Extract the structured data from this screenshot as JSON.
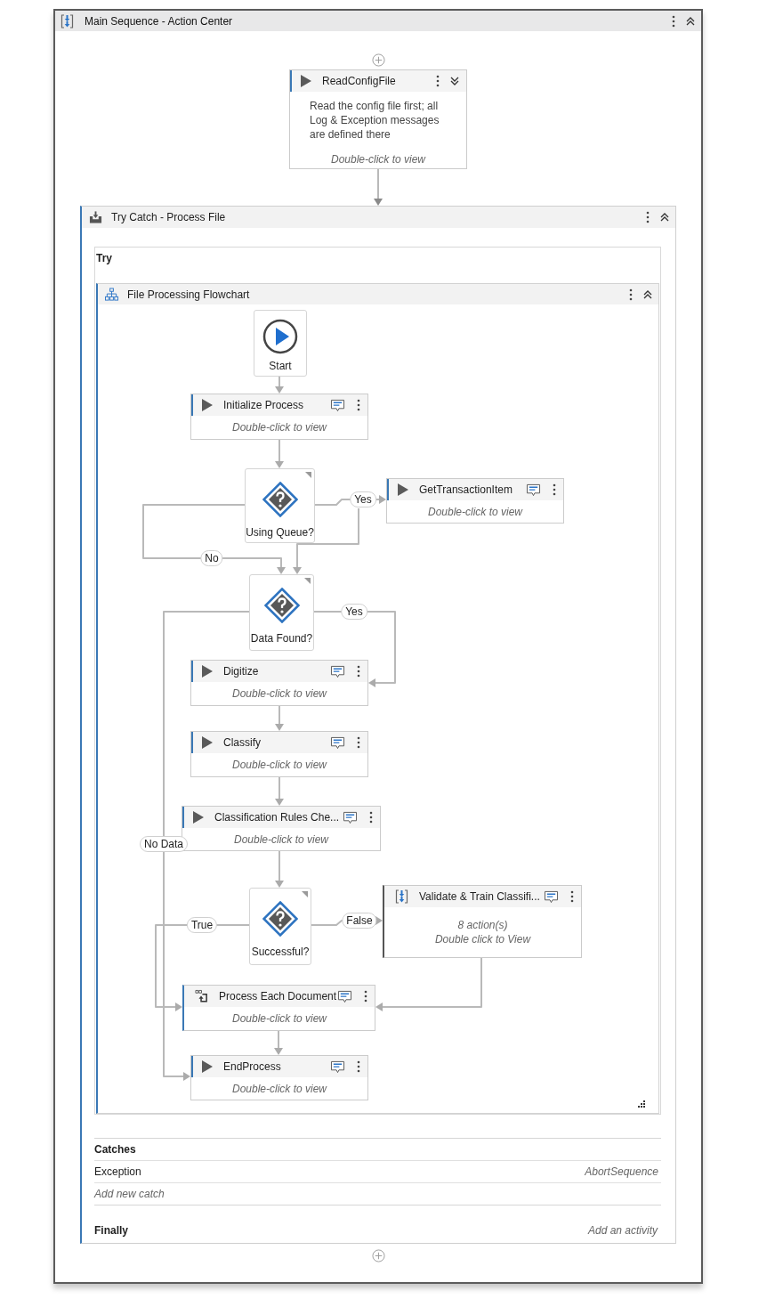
{
  "window": {
    "title": "Main Sequence - Action Center",
    "expanded": true
  },
  "top_activity": {
    "title": "ReadConfigFile",
    "expanded": false,
    "annotation": "Read the config file first; all Log & Exception messages are defined there",
    "hint": "Double-click to view"
  },
  "try_catch": {
    "title": "Try Catch - Process File",
    "expanded": true,
    "try": {
      "title": "Try",
      "flowchart": {
        "title": "File Processing Flowchart",
        "expanded": true,
        "nodes": [
          {
            "kind": "start",
            "label": "Start"
          },
          {
            "kind": "activity",
            "title": "Initialize Process",
            "hint": "Double-click to view"
          },
          {
            "kind": "decision",
            "label": "Using Queue?",
            "true_label": "Yes",
            "false_label": "No"
          },
          {
            "kind": "activity",
            "title": "GetTransactionItem",
            "hint": "Double-click to view"
          },
          {
            "kind": "decision",
            "label": "Data Found?",
            "true_label": "Yes",
            "false_label": "No Data"
          },
          {
            "kind": "activity",
            "title": "Digitize",
            "hint": "Double-click to view"
          },
          {
            "kind": "activity",
            "title": "Classify",
            "hint": "Double-click to view"
          },
          {
            "kind": "activity",
            "title": "Classification Rules Che...",
            "hint": "Double-click to view"
          },
          {
            "kind": "decision",
            "label": "Successful?",
            "true_label": "True",
            "false_label": "False"
          },
          {
            "kind": "sequence",
            "title": "Validate & Train Classifi...",
            "summary": "8 action(s)",
            "hint": "Double click to View"
          },
          {
            "kind": "foreach",
            "title": "Process Each Document",
            "hint": "Double-click to view"
          },
          {
            "kind": "activity",
            "title": "EndProcess",
            "hint": "Double-click to view"
          }
        ]
      }
    },
    "catches": {
      "title": "Catches",
      "items": [
        {
          "exception": "Exception",
          "handler": "AbortSequence"
        }
      ],
      "add_hint": "Add new catch"
    },
    "finally": {
      "title": "Finally",
      "hint": "Add an activity"
    }
  }
}
